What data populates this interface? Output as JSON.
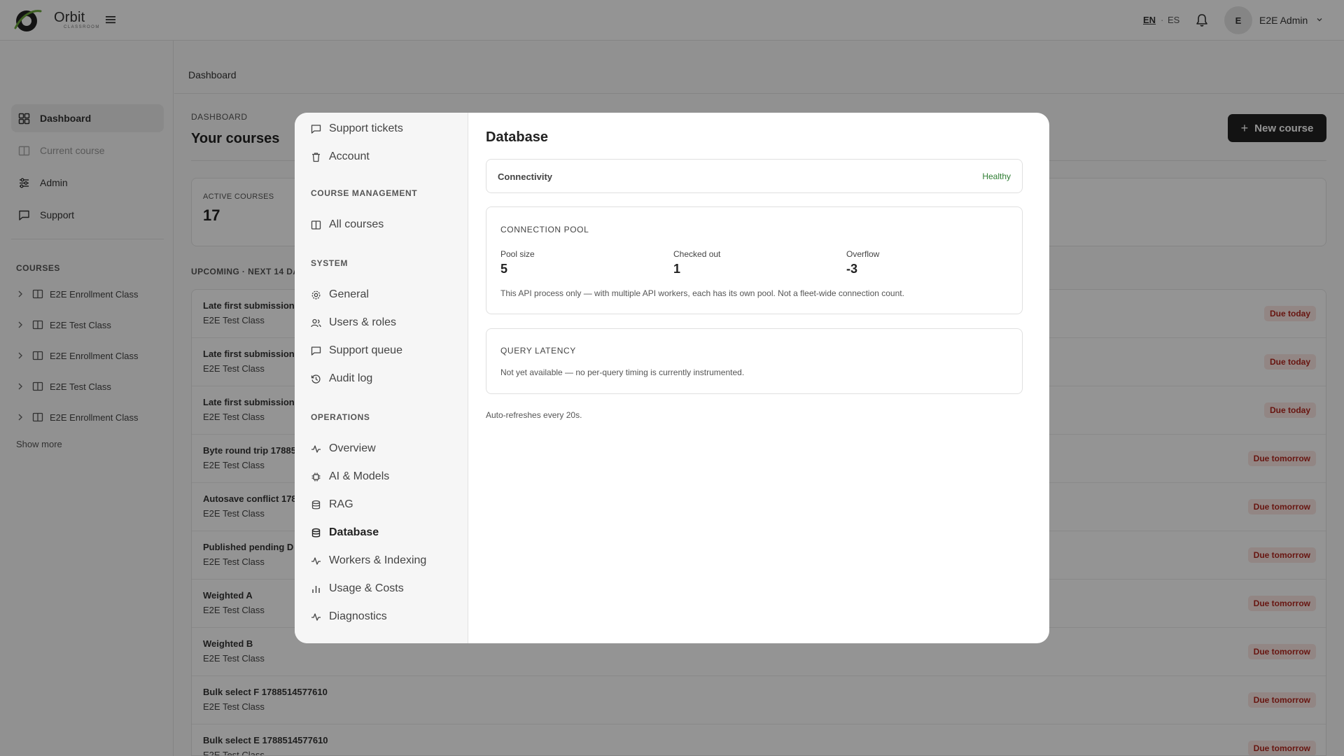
{
  "topbar": {
    "brand_name": "Orbit",
    "brand_sub": "CLASSROOM",
    "lang_en": "EN",
    "lang_sep": "·",
    "lang_es": "ES",
    "avatar_initial": "E",
    "user_name": "E2E Admin"
  },
  "sidebar": {
    "items": [
      {
        "label": "Dashboard",
        "icon": "grid-icon"
      },
      {
        "label": "Current course",
        "icon": "book-icon"
      },
      {
        "label": "Admin",
        "icon": "sliders-icon"
      },
      {
        "label": "Support",
        "icon": "chat-icon"
      }
    ],
    "courses_heading": "COURSES",
    "courses": [
      "E2E Enrollment Class",
      "E2E Test Class",
      "E2E Enrollment Class",
      "E2E Test Class",
      "E2E Enrollment Class"
    ],
    "show_more": "Show more"
  },
  "main": {
    "breadcrumb": "Dashboard",
    "kicker": "DASHBOARD",
    "title": "Your courses",
    "new_course_label": "New course",
    "stats": {
      "label": "ACTIVE COURSES",
      "value": "17"
    },
    "upcoming_heading": "UPCOMING · NEXT 14 DAYS",
    "due_items": [
      {
        "title": "Late first submission",
        "class": "E2E Test Class",
        "badge": "Due today"
      },
      {
        "title": "Late first submission",
        "class": "E2E Test Class",
        "badge": "Due today"
      },
      {
        "title": "Late first submission",
        "class": "E2E Test Class",
        "badge": "Due today"
      },
      {
        "title": "Byte round trip 17885",
        "class": "E2E Test Class",
        "badge": "Due tomorrow"
      },
      {
        "title": "Autosave conflict 178",
        "class": "E2E Test Class",
        "badge": "Due tomorrow"
      },
      {
        "title": "Published pending D",
        "class": "E2E Test Class",
        "badge": "Due tomorrow"
      },
      {
        "title": "Weighted A",
        "class": "E2E Test Class",
        "badge": "Due tomorrow"
      },
      {
        "title": "Weighted B",
        "class": "E2E Test Class",
        "badge": "Due tomorrow"
      },
      {
        "title": "Bulk select F 1788514577610",
        "class": "E2E Test Class",
        "badge": "Due tomorrow"
      },
      {
        "title": "Bulk select E 1788514577610",
        "class": "E2E Test Class",
        "badge": "Due tomorrow"
      }
    ]
  },
  "modal": {
    "nav_top": [
      {
        "label": "Support tickets",
        "icon": "chat-icon"
      },
      {
        "label": "Account",
        "icon": "trash-icon"
      }
    ],
    "sections": [
      {
        "heading": "COURSE MANAGEMENT",
        "items": [
          {
            "label": "All courses",
            "icon": "book-icon"
          }
        ]
      },
      {
        "heading": "SYSTEM",
        "items": [
          {
            "label": "General",
            "icon": "gear-icon"
          },
          {
            "label": "Users & roles",
            "icon": "users-icon"
          },
          {
            "label": "Support queue",
            "icon": "chat-icon"
          },
          {
            "label": "Audit log",
            "icon": "history-icon"
          }
        ]
      },
      {
        "heading": "OPERATIONS",
        "items": [
          {
            "label": "Overview",
            "icon": "pulse-icon"
          },
          {
            "label": "AI & Models",
            "icon": "cpu-icon"
          },
          {
            "label": "RAG",
            "icon": "database-icon"
          },
          {
            "label": "Database",
            "icon": "database-icon",
            "active": true
          },
          {
            "label": "Workers & Indexing",
            "icon": "pulse-icon"
          },
          {
            "label": "Usage & Costs",
            "icon": "bar-chart-icon"
          },
          {
            "label": "Diagnostics",
            "icon": "pulse-icon"
          }
        ]
      }
    ],
    "panel": {
      "title": "Database",
      "connectivity_label": "Connectivity",
      "connectivity_status": "Healthy",
      "status_color": "#2e7d32",
      "pool_heading": "CONNECTION POOL",
      "pool": [
        {
          "label": "Pool size",
          "value": "5"
        },
        {
          "label": "Checked out",
          "value": "1"
        },
        {
          "label": "Overflow",
          "value": "-3"
        }
      ],
      "pool_note": "This API process only — with multiple API workers, each has its own pool. Not a fleet-wide connection count.",
      "latency_heading": "QUERY LATENCY",
      "latency_note": "Not yet available — no per-query timing is currently instrumented.",
      "refresh_note": "Auto-refreshes every 20s."
    }
  }
}
